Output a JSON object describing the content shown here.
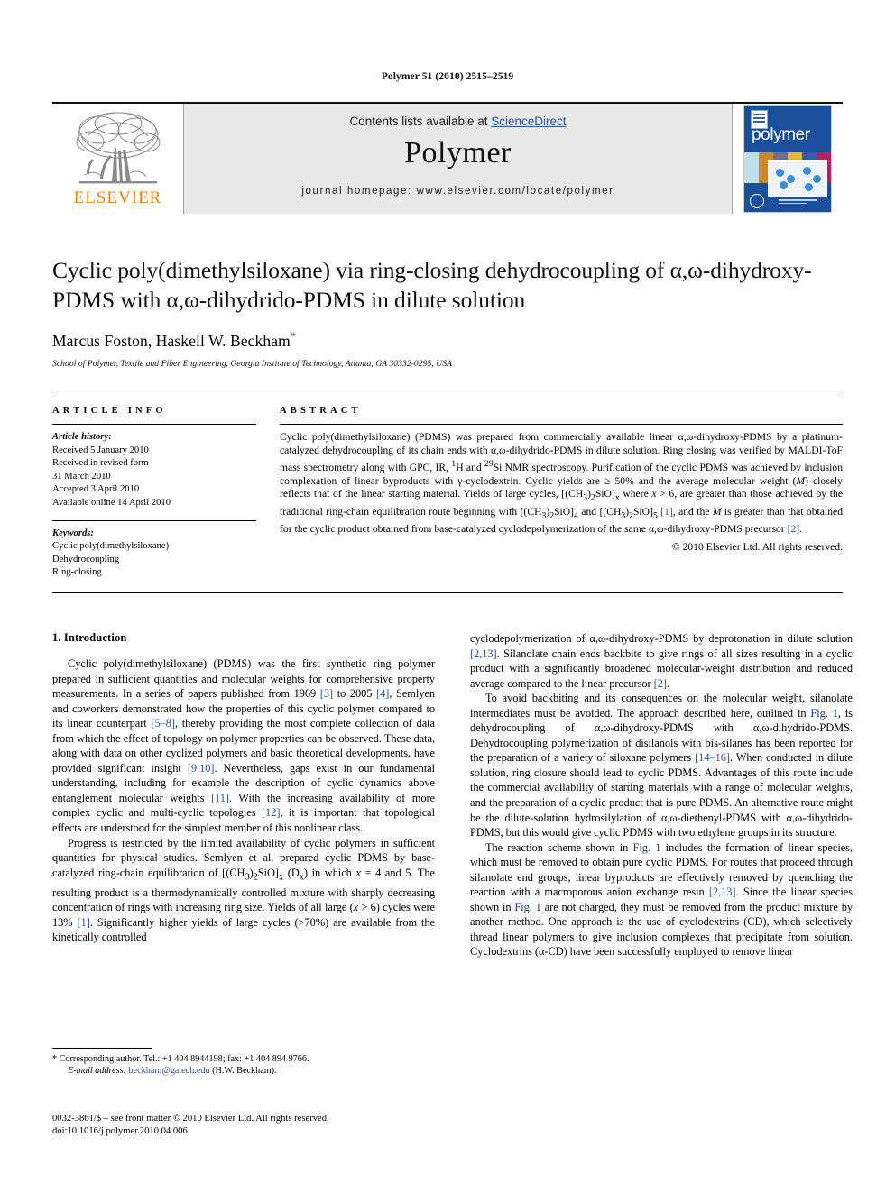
{
  "running_head": "Polymer 51 (2010) 2515–2519",
  "banner": {
    "contents_prefix": "Contents lists available at ",
    "sciencedirect": "ScienceDirect",
    "journal_title": "Polymer",
    "homepage": "journal homepage: www.elsevier.com/locate/polymer",
    "elsevier_wordmark": "ELSEVIER",
    "cover_title": "polymer",
    "accent_link_color": "#2b50a8",
    "cover_blue": "#1a4f9c",
    "elsevier_orange": "#f08000"
  },
  "title_block": {
    "title": "Cyclic poly(dimethylsiloxane) via ring-closing dehydrocoupling of α,ω-dihydroxy-PDMS with α,ω-dihydrido-PDMS in dilute solution",
    "authors": "Marcus Foston, Haskell W. Beckham",
    "corresponding_marker": "*",
    "affiliation": "School of Polymer, Textile and Fiber Engineering, Georgia Institute of Technology, Atlanta, GA 30332-0295, USA"
  },
  "article_info": {
    "heading": "ARTICLE INFO",
    "history_label": "Article history:",
    "history": [
      "Received 5 January 2010",
      "Received in revised form",
      "31 March 2010",
      "Accepted 3 April 2010",
      "Available online 14 April 2010"
    ],
    "keywords_label": "Keywords:",
    "keywords": [
      "Cyclic poly(dimethylsiloxane)",
      "Dehydrocoupling",
      "Ring-closing"
    ]
  },
  "abstract": {
    "heading": "ABSTRACT",
    "paragraph_html": "Cyclic poly(dimethylsiloxane) (PDMS) was prepared from commercially available linear α,ω-dihydroxy-PDMS by a platinum-catalyzed dehydrocoupling of its chain ends with α,ω-dihydrido-PDMS in dilute solution. Ring closing was verified by MALDI-ToF mass spectrometry along with GPC, IR, <sup>1</sup>H and <sup>29</sup>Si NMR spectroscopy. Purification of the cyclic PDMS was achieved by inclusion complexation of linear byproducts with γ-cyclodextrin. Cyclic yields are ≥ 50% and the average molecular weight (<i>M</i>) closely reflects that of the linear starting material. Yields of large cycles, [(CH<sub>3</sub>)<sub>2</sub>SiO]<sub>x</sub> where <i>x</i> &gt; 6, are greater than those achieved by the traditional ring-chain equilibration route beginning with [(CH<sub>3</sub>)<sub>2</sub>SiO]<sub>4</sub> and [(CH<sub>3</sub>)<sub>2</sub>SiO]<sub>5</sub> <span class=\"ref\">[1]</span>, and the <i>M</i> is greater than that obtained for the cyclic product obtained from base-catalyzed cyclodepolymerization of the same α,ω-dihydroxy-PDMS precursor <span class=\"ref\">[2]</span>.",
    "copyright": "© 2010 Elsevier Ltd. All rights reserved."
  },
  "body": {
    "section_title": "1. Introduction",
    "left_paragraphs_html": [
      "Cyclic poly(dimethylsiloxane) (PDMS) was the first synthetic ring polymer prepared in sufficient quantities and molecular weights for comprehensive property measurements. In a series of papers published from 1969 <span class=\"ref\">[3]</span> to 2005 <span class=\"ref\">[4]</span>, Semlyen and coworkers demonstrated how the properties of this cyclic polymer compared to its linear counterpart <span class=\"ref\">[5–8]</span>, thereby providing the most complete collection of data from which the effect of topology on polymer properties can be observed. These data, along with data on other cyclized polymers and basic theoretical developments, have provided significant insight <span class=\"ref\">[9,10]</span>. Nevertheless, gaps exist in our fundamental understanding, including for example the description of cyclic dynamics above entanglement molecular weights <span class=\"ref\">[11]</span>. With the increasing availability of more complex cyclic and multi-cyclic topologies <span class=\"ref\">[12]</span>, it is important that topological effects are understood for the simplest member of this nonlinear class.",
      "Progress is restricted by the limited availability of cyclic polymers in sufficient quantities for physical studies. Semlyen et al. prepared cyclic PDMS by base-catalyzed ring-chain equilibration of [(CH<sub>3</sub>)<sub>2</sub>SiO]<sub>x</sub> (D<sub>x</sub>) in which <i>x</i> = 4 and 5. The resulting product is a thermodynamically controlled mixture with sharply decreasing concentration of rings with increasing ring size. Yields of all large (<i>x</i> &gt; 6) cycles were 13% <span class=\"ref\">[1]</span>. Significantly higher yields of large cycles (&gt;70%) are available from the kinetically controlled"
    ],
    "right_paragraphs_html": [
      "cyclodepolymerization of α,ω-dihydroxy-PDMS by deprotonation in dilute solution <span class=\"ref\">[2,13]</span>. Silanolate chain ends backbite to give rings of all sizes resulting in a cyclic product with a significantly broadened molecular-weight distribution and reduced average compared to the linear precursor <span class=\"ref\">[2]</span>.",
      "To avoid backbiting and its consequences on the molecular weight, silanolate intermediates must be avoided. The approach described here, outlined in <span class=\"lnk\">Fig. 1</span>, is dehydrocoupling of α,ω-dihydroxy-PDMS with α,ω-dihydrido-PDMS. Dehydrocoupling polymerization of disilanols with bis-silanes has been reported for the preparation of a variety of siloxane polymers <span class=\"ref\">[14–16]</span>. When conducted in dilute solution, ring closure should lead to cyclic PDMS. Advantages of this route include the commercial availability of starting materials with a range of molecular weights, and the preparation of a cyclic product that is pure PDMS. An alternative route might be the dilute-solution hydrosilylation of α,ω-diethenyl-PDMS with α,ω-dihydrido-PDMS, but this would give cyclic PDMS with two ethylene groups in its structure.",
      "The reaction scheme shown in <span class=\"lnk\">Fig. 1</span> includes the formation of linear species, which must be removed to obtain pure cyclic PDMS. For routes that proceed through silanolate end groups, linear byproducts are effectively removed by quenching the reaction with a macroporous anion exchange resin <span class=\"ref\">[2,13]</span>. Since the linear species shown in <span class=\"lnk\">Fig. 1</span> are not charged, they must be removed from the product mixture by another method. One approach is the use of cyclodextrins (CD), which selectively thread linear polymers to give inclusion complexes that precipitate from solution. Cyclodextrins (α-CD) have been successfully employed to remove linear"
    ]
  },
  "footnote": {
    "corresponding_html": "* Corresponding author. Tel.: +1 404 8944198; fax: +1 404 894 9766.",
    "email_label": "E-mail address:",
    "email": "beckham@gatech.edu",
    "email_suffix": "(H.W. Beckham)."
  },
  "imprint": {
    "line1": "0032-3861/$ – see front matter © 2010 Elsevier Ltd. All rights reserved.",
    "line2": "doi:10.1016/j.polymer.2010.04.006"
  }
}
